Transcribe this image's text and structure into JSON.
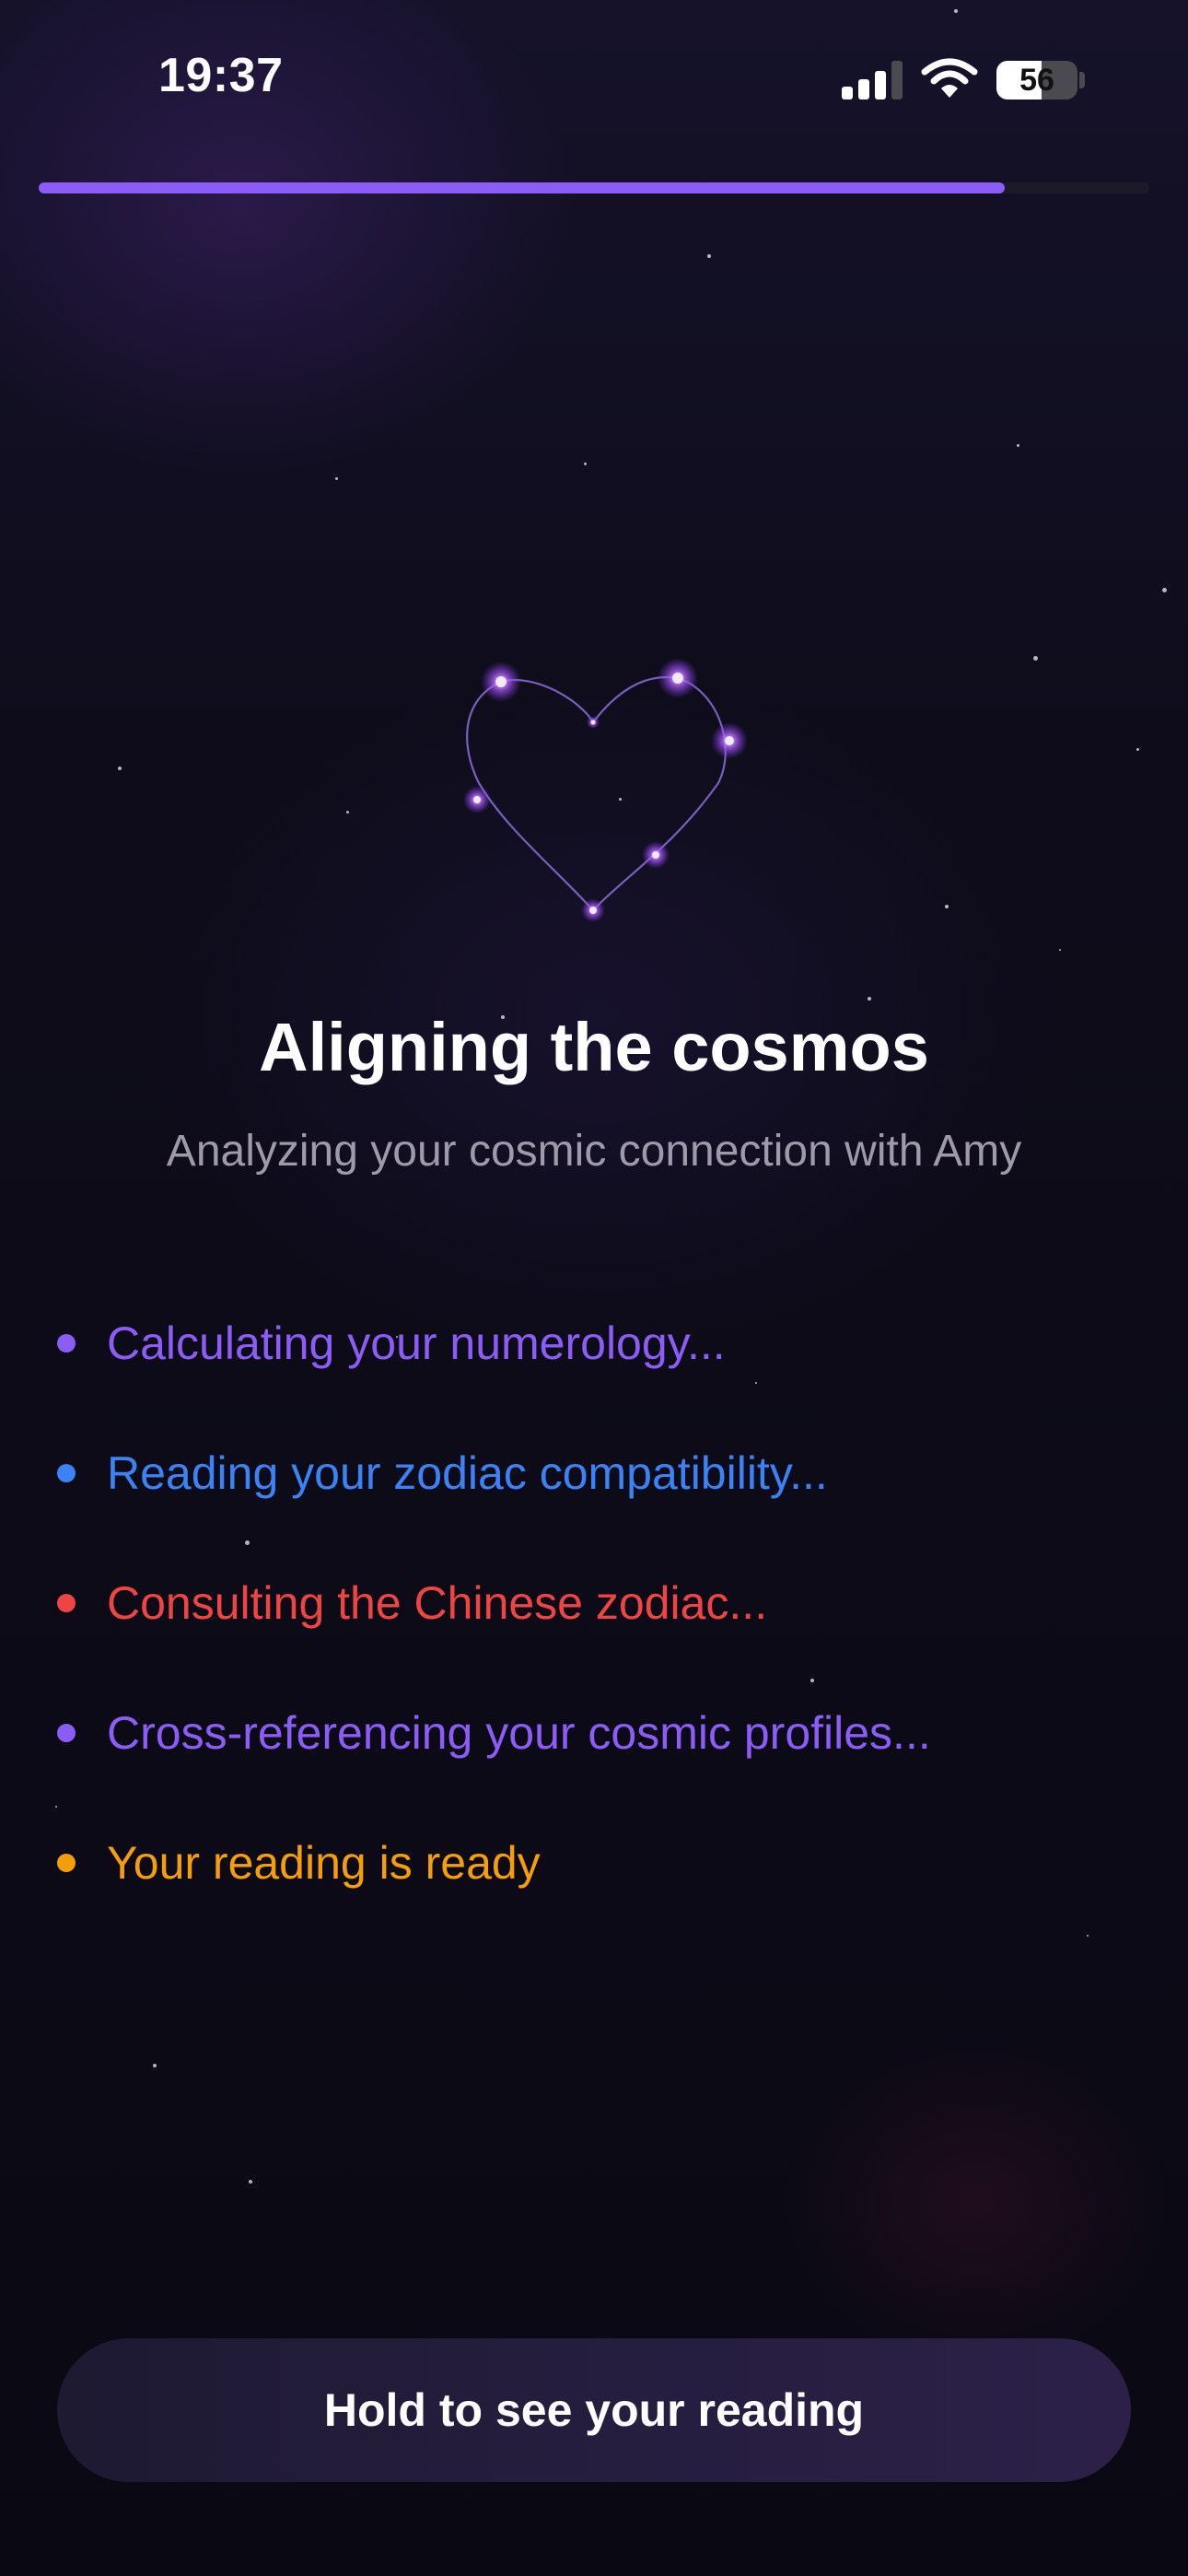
{
  "status_bar": {
    "time": "19:37",
    "battery_level": "56",
    "battery_fraction": 0.56
  },
  "progress": {
    "fraction": 0.87
  },
  "main": {
    "title": "Aligning the cosmos",
    "subtitle": "Analyzing your cosmic connection with Amy",
    "steps": [
      {
        "label": "Calculating your numerology...",
        "color": "#8b5cf6"
      },
      {
        "label": "Reading your zodiac compatibility...",
        "color": "#3b82f6"
      },
      {
        "label": "Consulting the Chinese zodiac...",
        "color": "#ef4444"
      },
      {
        "label": "Cross-referencing your cosmic profiles...",
        "color": "#8b5cf6"
      },
      {
        "label": "Your reading is ready",
        "color": "#f59e0b"
      }
    ]
  },
  "cta": {
    "label": "Hold to see your reading"
  },
  "colors": {
    "accent": "#8b5cf6",
    "background": "#0b0a14"
  },
  "icons": {
    "heart": "constellation-heart-icon",
    "signal": "signal-icon",
    "wifi": "wifi-icon",
    "battery": "battery-icon"
  }
}
